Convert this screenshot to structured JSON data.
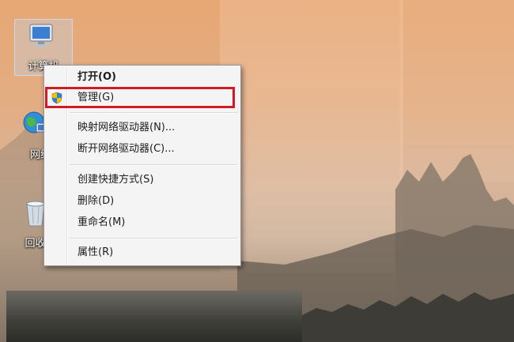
{
  "desktop": {
    "icons": [
      {
        "label": "计算机",
        "icon": "computer-icon"
      },
      {
        "label": "网络",
        "icon": "network-icon"
      },
      {
        "label": "回收站",
        "icon": "recycle-bin-icon"
      }
    ]
  },
  "context_menu": {
    "items": [
      {
        "label": "打开(O)",
        "bold": true
      },
      {
        "label": "管理(G)",
        "icon": "shield-icon",
        "highlighted": true
      },
      {
        "label": "映射网络驱动器(N)..."
      },
      {
        "label": "断开网络驱动器(C)..."
      },
      {
        "label": "创建快捷方式(S)"
      },
      {
        "label": "删除(D)"
      },
      {
        "label": "重命名(M)"
      },
      {
        "label": "属性(R)"
      }
    ]
  },
  "colors": {
    "highlight": "#d11a23",
    "menu_background": "#f4f4f4"
  }
}
